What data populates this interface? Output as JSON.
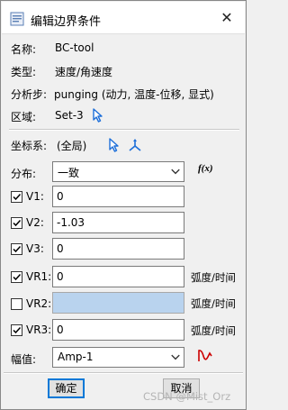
{
  "window": {
    "title": "编辑边界条件",
    "close_glyph": "✕"
  },
  "info": {
    "name_label": "名称:",
    "name_value": "BC-tool",
    "type_label": "类型:",
    "type_value": "速度/角速度",
    "step_label": "分析步:",
    "step_value": "punging (动力, 温度-位移, 显式)",
    "region_label": "区域:",
    "region_value": "Set-3"
  },
  "csys": {
    "label": "坐标系:",
    "value": "(全局)"
  },
  "distribution": {
    "label": "分布:",
    "selected": "一致",
    "fx_label": "f(x)"
  },
  "fields": [
    {
      "label": "V1:",
      "checked": true,
      "value": "0",
      "unit": ""
    },
    {
      "label": "V2:",
      "checked": true,
      "value": "-1.03",
      "unit": ""
    },
    {
      "label": "V3:",
      "checked": true,
      "value": "0",
      "unit": ""
    },
    {
      "label": "VR1:",
      "checked": true,
      "value": "0",
      "unit": "弧度/时间"
    },
    {
      "label": "VR2:",
      "checked": false,
      "value": "",
      "unit": "弧度/时间"
    },
    {
      "label": "VR3:",
      "checked": true,
      "value": "0",
      "unit": "弧度/时间"
    }
  ],
  "amplitude": {
    "label": "幅值:",
    "selected": "Amp-1"
  },
  "buttons": {
    "ok": "确定",
    "cancel": "取消"
  },
  "watermark": "CSDN @Mist_Orz",
  "colors": {
    "accent": "#0078d7",
    "disabled_field": "#b9d3ee",
    "amp_icon": "#cc0000",
    "pick_icon": "#1e6fd9"
  }
}
